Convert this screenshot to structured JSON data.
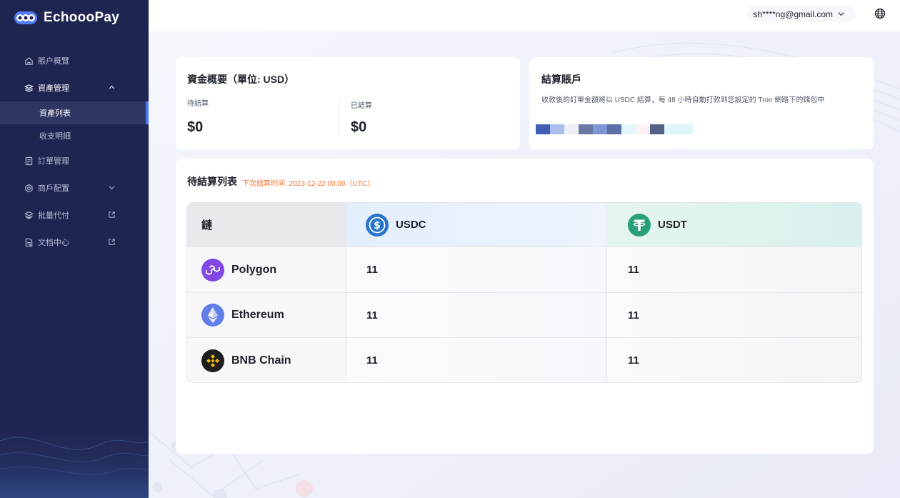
{
  "app": {
    "name": "EchoooPay"
  },
  "sidebar": {
    "items": [
      {
        "label": "賬户概覽",
        "icon": "home-icon"
      },
      {
        "label": "資產管理",
        "icon": "layers-icon",
        "expanded": true,
        "children": [
          {
            "label": "資產列表",
            "active": true
          },
          {
            "label": "收支明細"
          }
        ]
      },
      {
        "label": "訂單管理",
        "icon": "document-icon"
      },
      {
        "label": "商戶配置",
        "icon": "settings-icon"
      },
      {
        "label": "批量代付",
        "icon": "stack-icon",
        "external": true
      },
      {
        "label": "文档中心",
        "icon": "docs-icon",
        "external": true
      }
    ]
  },
  "header": {
    "user_email": "sh****ng@gmail.com",
    "language_icon": "globe-icon"
  },
  "funds_card": {
    "title": "資金概要（單位: USD）",
    "pending_label": "待結算",
    "pending_value": "$0",
    "settled_label": "已結算",
    "settled_value": "$0"
  },
  "settle_card": {
    "title": "結算賬戶",
    "description": "收款後的訂單金額將以 USDC 結算，每 48 小時自動打款到您設定的 Tron 網路下的錢包中",
    "address_redacted": true
  },
  "pending_list": {
    "title": "待結算列表",
    "next_settlement": "下次结算时间: 2023-12-22 00:00（UTC）",
    "columns": [
      "鏈",
      "USDC",
      "USDT"
    ],
    "rows": [
      {
        "chain": "Polygon",
        "usdc": "11",
        "usdt": "11",
        "icon": "polygon-icon"
      },
      {
        "chain": "Ethereum",
        "usdc": "11",
        "usdt": "11",
        "icon": "ethereum-icon"
      },
      {
        "chain": "BNB Chain",
        "usdc": "11",
        "usdt": "11",
        "icon": "bnb-chain-icon"
      }
    ]
  },
  "colors": {
    "sidebar_bg": "#1f2551",
    "accent": "#4d7bf3",
    "warning_text": "#f77234",
    "usdc_blue": "#2775ca",
    "usdt_green": "#26a17b"
  }
}
